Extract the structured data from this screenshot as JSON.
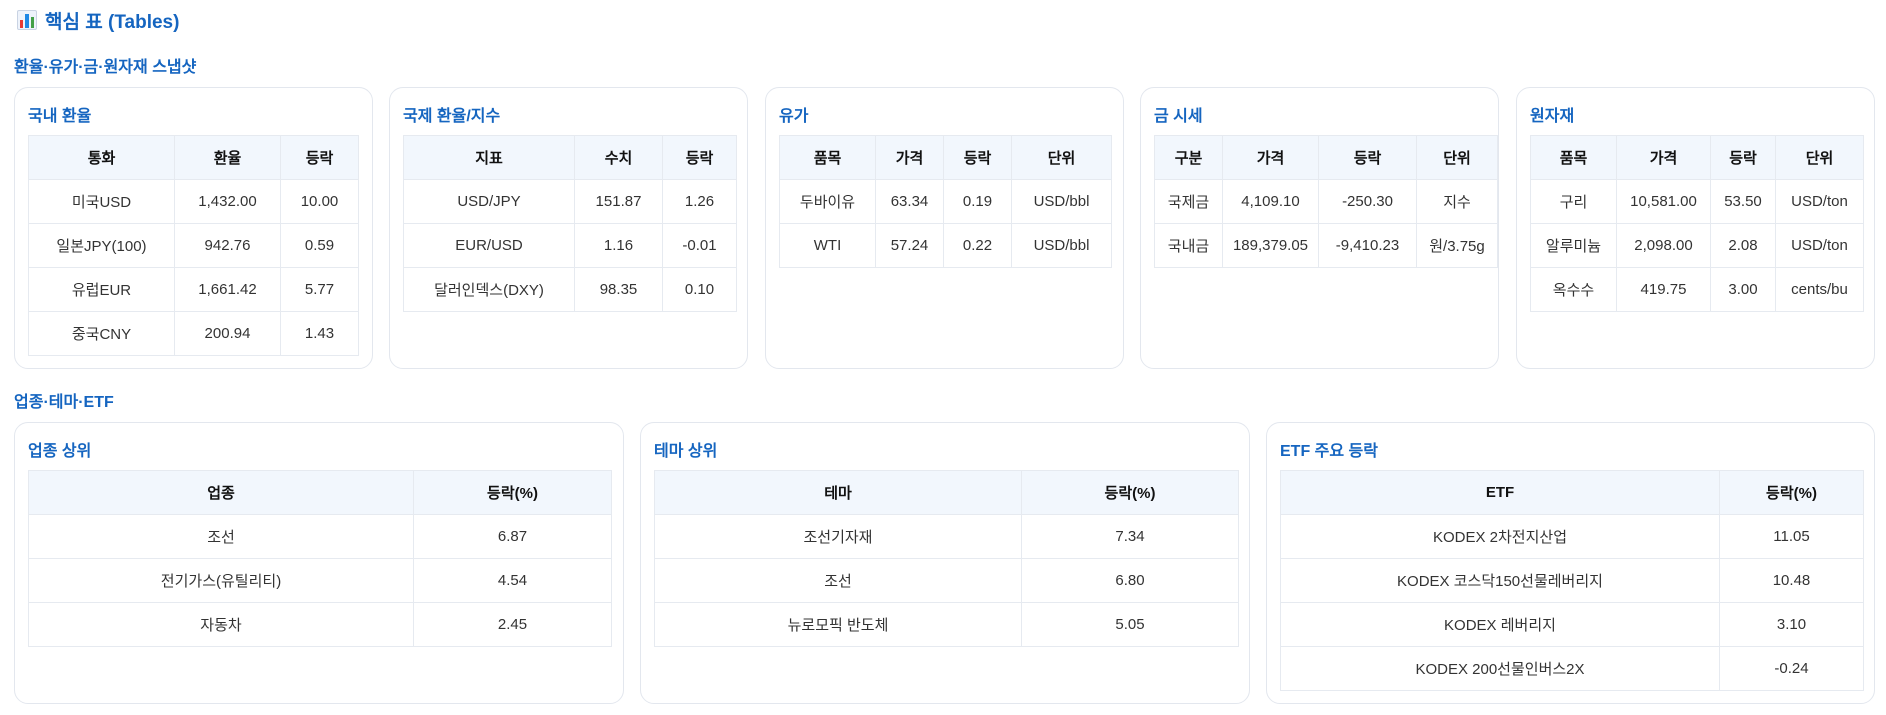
{
  "page": {
    "title": "핵심 표 (Tables)",
    "icon": "bar-chart-icon"
  },
  "sections": {
    "market": {
      "title": "환율·유가·금·원자재 스냅샷"
    },
    "sector": {
      "title": "업종·테마·ETF"
    }
  },
  "tables": {
    "fx_domestic": {
      "title": "국내 환율",
      "headers": [
        "통화",
        "환율",
        "등락"
      ],
      "rows": [
        [
          "미국USD",
          "1,432.00",
          "10.00"
        ],
        [
          "일본JPY(100)",
          "942.76",
          "0.59"
        ],
        [
          "유럽EUR",
          "1,661.42",
          "5.77"
        ],
        [
          "중국CNY",
          "200.94",
          "1.43"
        ]
      ]
    },
    "fx_intl": {
      "title": "국제 환율/지수",
      "headers": [
        "지표",
        "수치",
        "등락"
      ],
      "rows": [
        [
          "USD/JPY",
          "151.87",
          "1.26"
        ],
        [
          "EUR/USD",
          "1.16",
          "-0.01"
        ],
        [
          "달러인덱스(DXY)",
          "98.35",
          "0.10"
        ]
      ]
    },
    "oil": {
      "title": "유가",
      "headers": [
        "품목",
        "가격",
        "등락",
        "단위"
      ],
      "rows": [
        [
          "두바이유",
          "63.34",
          "0.19",
          "USD/bbl"
        ],
        [
          "WTI",
          "57.24",
          "0.22",
          "USD/bbl"
        ]
      ]
    },
    "gold": {
      "title": "금 시세",
      "headers": [
        "구분",
        "가격",
        "등락",
        "단위"
      ],
      "rows": [
        [
          "국제금",
          "4,109.10",
          "-250.30",
          "지수"
        ],
        [
          "국내금",
          "189,379.05",
          "-9,410.23",
          "원/3.75g"
        ]
      ]
    },
    "commodities": {
      "title": "원자재",
      "headers": [
        "품목",
        "가격",
        "등락",
        "단위"
      ],
      "rows": [
        [
          "구리",
          "10,581.00",
          "53.50",
          "USD/ton"
        ],
        [
          "알루미늄",
          "2,098.00",
          "2.08",
          "USD/ton"
        ],
        [
          "옥수수",
          "419.75",
          "3.00",
          "cents/bu"
        ]
      ]
    },
    "sector_top": {
      "title": "업종 상위",
      "headers": [
        "업종",
        "등락(%)"
      ],
      "rows": [
        [
          "조선",
          "6.87"
        ],
        [
          "전기가스(유틸리티)",
          "4.54"
        ],
        [
          "자동차",
          "2.45"
        ]
      ]
    },
    "theme_top": {
      "title": "테마 상위",
      "headers": [
        "테마",
        "등락(%)"
      ],
      "rows": [
        [
          "조선기자재",
          "7.34"
        ],
        [
          "조선",
          "6.80"
        ],
        [
          "뉴로모픽 반도체",
          "5.05"
        ]
      ]
    },
    "etf": {
      "title": "ETF 주요 등락",
      "headers": [
        "ETF",
        "등락(%)"
      ],
      "rows": [
        [
          "KODEX 2차전지산업",
          "11.05"
        ],
        [
          "KODEX 코스닥150선물레버리지",
          "10.48"
        ],
        [
          "KODEX 레버리지",
          "3.10"
        ],
        [
          "KODEX 200선물인버스2X",
          "-0.24"
        ]
      ]
    }
  }
}
